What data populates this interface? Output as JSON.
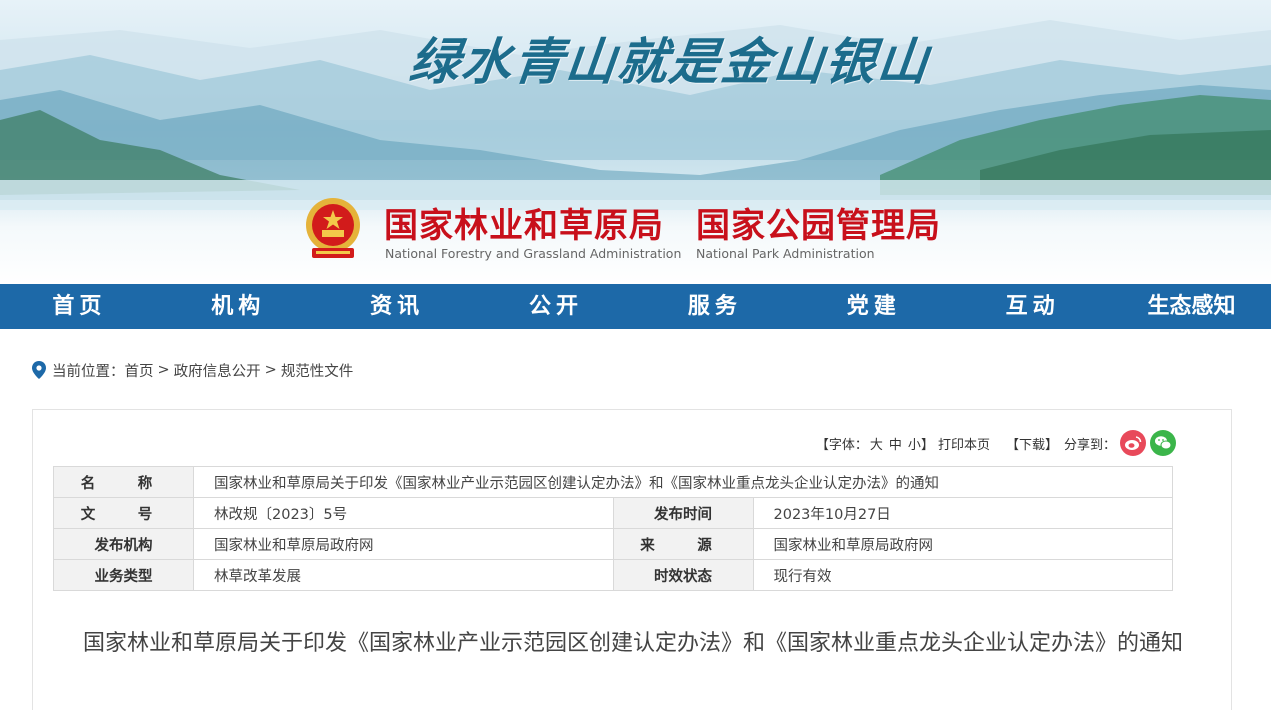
{
  "banner": {
    "slogan": "绿水青山就是金山银山",
    "org_cn_1": "国家林业和草原局",
    "org_cn_2": "国家公园管理局",
    "org_en_1": "National Forestry and Grassland Administration",
    "org_en_2": "National Park Administration"
  },
  "nav": {
    "items": [
      "首页",
      "机构",
      "资讯",
      "公开",
      "服务",
      "党建",
      "互动",
      "生态感知"
    ]
  },
  "breadcrumb": {
    "prefix": "当前位置：",
    "items": [
      "首页",
      "政府信息公开",
      "规范性文件"
    ],
    "sep": ">"
  },
  "tools": {
    "font_prefix": "【字体：",
    "font_large": "大",
    "font_medium": "中",
    "font_small": "小",
    "font_suffix": "】",
    "print": "打印本页",
    "download": "【下载】",
    "share": "分享到："
  },
  "meta": {
    "name_label": "名　称",
    "name_value": "国家林业和草原局关于印发《国家林业产业示范园区创建认定办法》和《国家林业重点龙头企业认定办法》的通知",
    "doc_no_label": "文　号",
    "doc_no_value": "林改规〔2023〕5号",
    "pub_time_label": "发布时间",
    "pub_time_value": "2023年10月27日",
    "issuer_label": "发布机构",
    "issuer_value": "国家林业和草原局政府网",
    "source_label": "来　源",
    "source_value": "国家林业和草原局政府网",
    "biz_type_label": "业务类型",
    "biz_type_value": "林草改革发展",
    "status_label": "时效状态",
    "status_value": "现行有效"
  },
  "doc_title": "国家林业和草原局关于印发《国家林业产业示范园区创建认定办法》和《国家林业重点龙头企业认定办法》的通知",
  "colors": {
    "nav_bg": "#1d69a8",
    "org_red": "#c8101b",
    "weibo": "#e8495a",
    "wechat": "#3bb54a"
  }
}
